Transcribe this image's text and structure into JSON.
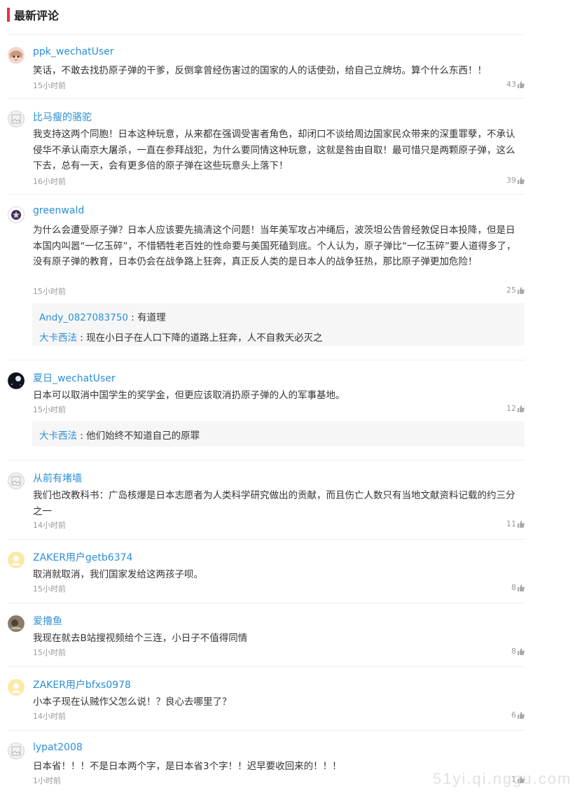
{
  "section": {
    "title": "最新评论",
    "accent_color": "#e8323f"
  },
  "colors": {
    "username": "#2b8fd6",
    "meta": "#999999"
  },
  "like_icon": "thumbs-up-icon",
  "comments": [
    {
      "user": "ppk_wechatUser",
      "avatar": "anime-girl-avatar",
      "text": "笑话，不敢去找扔原子弹的干爹，反倒拿曾经伤害过的国家的人的话使劲，给自己立牌坊。算个什么东西！！",
      "time": "15小时前",
      "likes": "43",
      "replies": []
    },
    {
      "user": "比马瘦的骆驼",
      "avatar": "default-avatar",
      "text": "我支持这两个同胞！日本这种玩意，从来都在强调受害者角色，却闭口不谈给周边国家民众带来的深重罪孽，不承认侵华不承认南京大屠杀，一直在参拜战犯，为什么要同情这种玩意，这就是咎由自取！最可惜只是两颗原子弹，这么下去，总有一天，会有更多倍的原子弹在这些玩意头上落下！",
      "time": "16小时前",
      "likes": "39",
      "replies": []
    },
    {
      "user": "greenwald",
      "avatar": "badge-avatar",
      "text": "为什么会遭受原子弹？日本人应该要先搞清这个问题！当年美军攻占冲绳后，波茨坦公告曾经敦促日本投降，但是日本国内叫嚣“一亿玉碎”，不惜牺牲老百姓的性命要与美国死磕到底。个人认为，原子弹比“一亿玉碎”要人道得多了，没有原子弹的教育，日本仍会在战争路上狂奔，真正反人类的是日本人的战争狂热，那比原子弹更加危险！",
      "time": "15小时前",
      "likes": "25",
      "replies": [
        {
          "user": "Andy_0827083750",
          "text": "有道理"
        },
        {
          "user": "大卡西法",
          "text": "现在小日子在人口下降的道路上狂奔，人不自救天必灭之"
        }
      ]
    },
    {
      "user": "夏日_wechatUser",
      "avatar": "dark-space-avatar",
      "text": "日本可以取消中国学生的奖学金，但更应该取消扔原子弹的人的军事基地。",
      "time": "15小时前",
      "likes": "12",
      "replies": [
        {
          "user": "大卡西法",
          "text": "他们始终不知道自己的原罪"
        }
      ]
    },
    {
      "user": "从前有堵墙",
      "avatar": "default-avatar",
      "text": "我们也改教科书：广岛核爆是日本志愿者为人类科学研究做出的贡献，而且伤亡人数只有当地文献资料记载的约三分之一",
      "time": "14小时前",
      "likes": "11",
      "replies": []
    },
    {
      "user": "ZAKER用户getb6374",
      "avatar": "yellow-default-avatar",
      "text": "取消就取消，我们国家发给这两孩子呗。",
      "time": "15小时前",
      "likes": "8",
      "replies": []
    },
    {
      "user": "爱撸鱼",
      "avatar": "photo-avatar",
      "text": "我现在就去B站搜视频给个三连，小日子不值得同情",
      "time": "15小时前",
      "likes": "8",
      "replies": []
    },
    {
      "user": "ZAKER用户bfxs0978",
      "avatar": "yellow-default-avatar",
      "text": "小本子现在认贼作父怎么说！？良心去哪里了？",
      "time": "14小时前",
      "likes": "6",
      "replies": []
    },
    {
      "user": "lypat2008",
      "avatar": "default-avatar",
      "text": "日本省！！！不是日本两个字，是日本省3个字！！迟早要收回来的！！！",
      "time": "1小时前",
      "likes": "1",
      "replies": []
    }
  ],
  "watermark": "51yi.qi.nggu.com"
}
